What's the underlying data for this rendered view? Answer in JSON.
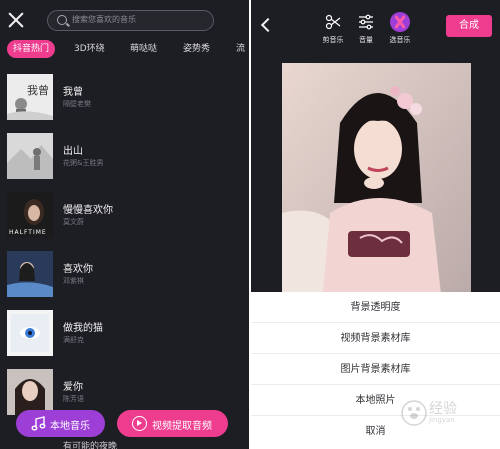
{
  "left_panel": {
    "search": {
      "placeholder": "搜索您喜欢的音乐"
    },
    "tabs": [
      "抖音热门",
      "3D环绕",
      "萌哒哒",
      "姿势秀",
      "流"
    ],
    "active_tab": "抖音热门",
    "songs": [
      {
        "title": "我曾",
        "artist": "隔壁老樊",
        "cover_text": "我曾"
      },
      {
        "title": "出山",
        "artist": "花粥&王胜男"
      },
      {
        "title": "慢慢喜欢你",
        "artist": "莫文蔚",
        "cover_text": "HALFTIME"
      },
      {
        "title": "喜欢你",
        "artist": "邓紫棋"
      },
      {
        "title": "做我的猫",
        "artist": "满舒克"
      },
      {
        "title": "爱你",
        "artist": "陈芳语"
      }
    ],
    "next_song_peek": "有可能的夜晚",
    "buttons": {
      "local_music": "本地音乐",
      "video_extract": "视频提取音频"
    }
  },
  "right_panel": {
    "tools": [
      {
        "label": "剪音乐",
        "icon": "scissors-icon"
      },
      {
        "label": "音量",
        "icon": "sliders-icon"
      },
      {
        "label": "选音乐",
        "icon": "music-disc-icon"
      }
    ],
    "compose_label": "合成",
    "sheet_options": [
      "背景透明度",
      "视频背景素材库",
      "图片背景素材库",
      "本地照片",
      "取消"
    ],
    "watermark": {
      "text": "经验",
      "sub": "jingyan"
    }
  },
  "colors": {
    "background": "#1d1d24",
    "accent_pink": "#ee3d8f",
    "accent_purple": "#9d3fd6"
  }
}
